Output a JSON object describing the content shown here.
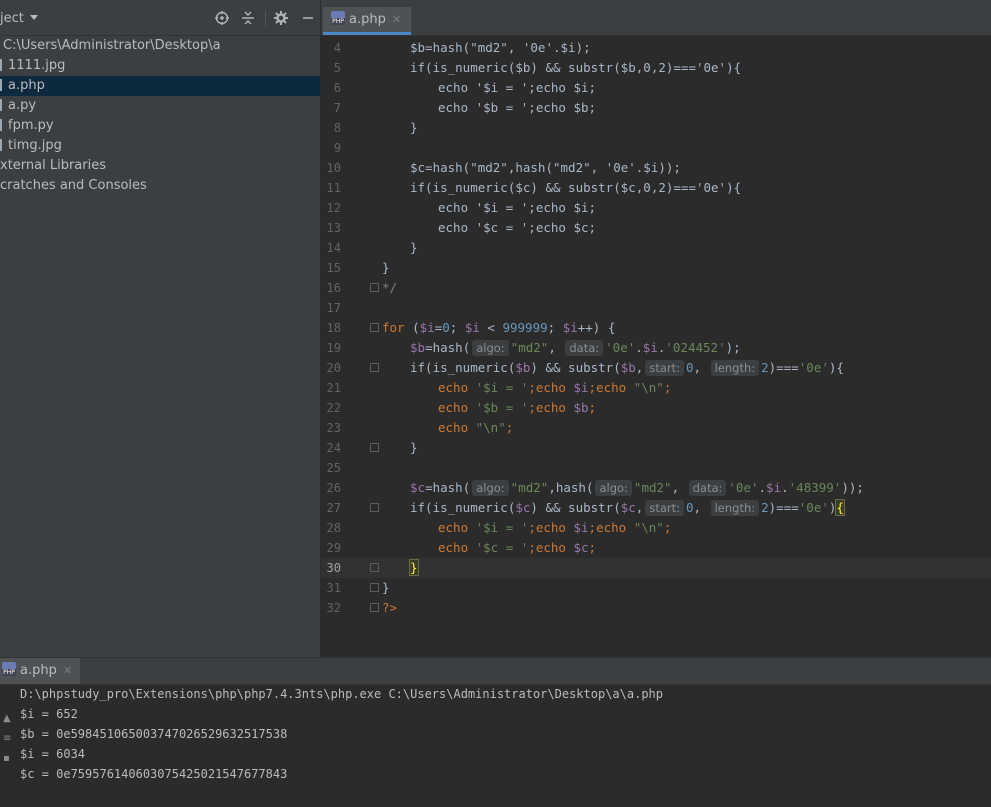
{
  "project": {
    "title": "ject",
    "root_path": "C:\\Users\\Administrator\\Desktop\\a",
    "files": [
      "1111.jpg",
      "a.php",
      "a.py",
      "fpm.py",
      "timg.jpg"
    ],
    "selected_file": "a.php",
    "external_libraries": "xternal Libraries",
    "scratches": "cratches and Consoles",
    "toolbar_icons": [
      "locate-icon",
      "collapse-icon",
      "gear-icon",
      "minimize-icon"
    ]
  },
  "editor": {
    "tab_label": "a.php",
    "tab_close": "✕",
    "current_line": 30,
    "line_numbers": [
      "4",
      "5",
      "6",
      "7",
      "8",
      "9",
      "10",
      "11",
      "12",
      "13",
      "14",
      "15",
      "16",
      "17",
      "18",
      "19",
      "20",
      "21",
      "22",
      "23",
      "24",
      "25",
      "26",
      "27",
      "28",
      "29",
      "30",
      "31",
      "32"
    ],
    "hints": {
      "algo": "algo:",
      "data": "data:",
      "start": "start:",
      "length": "length:"
    },
    "code": {
      "l4": "$b=hash(\"md2\", '0e'.$i);",
      "l5": "if(is_numeric($b) && substr($b,0,2)==='0e'){",
      "l6": "echo '$i = ';echo $i;",
      "l7": "echo '$b = ';echo $b;",
      "l8": "}",
      "l10": "$c=hash(\"md2\",hash(\"md2\", '0e'.$i));",
      "l11": "if(is_numeric($c) && substr($c,0,2)==='0e'){",
      "l12": "echo '$i = ';echo $i;",
      "l13": "echo '$c = ';echo $c;",
      "l14": "}",
      "l15": "}",
      "l16": "*/",
      "l18_kw": "for",
      "l18_a": " (",
      "l18_v1": "$i",
      "l18_b": "=",
      "l18_n1": "0",
      "l18_c": "; ",
      "l18_v2": "$i",
      "l18_d": " < ",
      "l18_n2": "999999",
      "l18_e": "; ",
      "l18_v3": "$i",
      "l18_f": "++) {",
      "l19_v": "$b",
      "l19_a": "=hash(",
      "l19_s1": "\"md2\"",
      "l19_b": ", ",
      "l19_s2": "'0e'",
      "l19_c": ".",
      "l19_v2": "$i",
      "l19_d": ".",
      "l19_s3": "'024452'",
      "l19_e": ");",
      "l20_a": "if(is_numeric(",
      "l20_v": "$b",
      "l20_b": ") && substr(",
      "l20_v2": "$b",
      "l20_c": ",",
      "l20_n1": "0",
      "l20_d": ", ",
      "l20_n2": "2",
      "l20_e": ")===",
      "l20_s": "'0e'",
      "l20_f": "){",
      "l21_kw": "echo",
      "l21_s": " '$i = '",
      "l21_a": ";",
      "l21_kw2": "echo",
      "l21_v": " $i",
      "l21_b": ";",
      "l21_kw3": "echo",
      "l21_s2": " \"\\n\"",
      "l21_c": ";",
      "l22_kw": "echo",
      "l22_s": " '$b = '",
      "l22_a": ";",
      "l22_kw2": "echo",
      "l22_v": " $b",
      "l22_b": ";",
      "l23_kw": "echo",
      "l23_s": " \"\\n\"",
      "l23_a": ";",
      "l24": "}",
      "l26_v": "$c",
      "l26_a": "=hash(",
      "l26_s1": "\"md2\"",
      "l26_b": ",hash(",
      "l26_s2": "\"md2\"",
      "l26_c": ", ",
      "l26_s3": "'0e'",
      "l26_d": ".",
      "l26_v2": "$i",
      "l26_e": ".",
      "l26_s4": "'48399'",
      "l26_f": "));",
      "l27_a": "if(is_numeric(",
      "l27_v": "$c",
      "l27_b": ") && substr(",
      "l27_v2": "$c",
      "l27_c": ",",
      "l27_n1": "0",
      "l27_d": ", ",
      "l27_n2": "2",
      "l27_e": ")===",
      "l27_s": "'0e'",
      "l27_f": ")",
      "l27_g": "{",
      "l28_kw": "echo",
      "l28_s": " '$i = '",
      "l28_a": ";",
      "l28_kw2": "echo",
      "l28_v": " $i",
      "l28_b": ";",
      "l28_kw3": "echo",
      "l28_s2": " \"\\n\"",
      "l28_c": ";",
      "l29_kw": "echo",
      "l29_s": " '$c = '",
      "l29_a": ";",
      "l29_kw2": "echo",
      "l29_v": " $c",
      "l29_b": ";",
      "l30": "}",
      "l31": "}",
      "l32": "?>"
    }
  },
  "run": {
    "tab_label": "a.php",
    "tab_close": "✕",
    "output": [
      "D:\\phpstudy_pro\\Extensions\\php\\php7.4.3nts\\php.exe C:\\Users\\Administrator\\Desktop\\a\\a.php",
      "$i = 652",
      "$b = 0e598451065003747026529632517538",
      "$i = 6034",
      "$c = 0e759576140603075425021547677843"
    ]
  },
  "colors": {
    "keyword": "#cc7832",
    "variable": "#9876aa",
    "string": "#6a8759",
    "number": "#6897bb",
    "selection": "#0d293e",
    "tab_underline": "#4a88c7"
  }
}
